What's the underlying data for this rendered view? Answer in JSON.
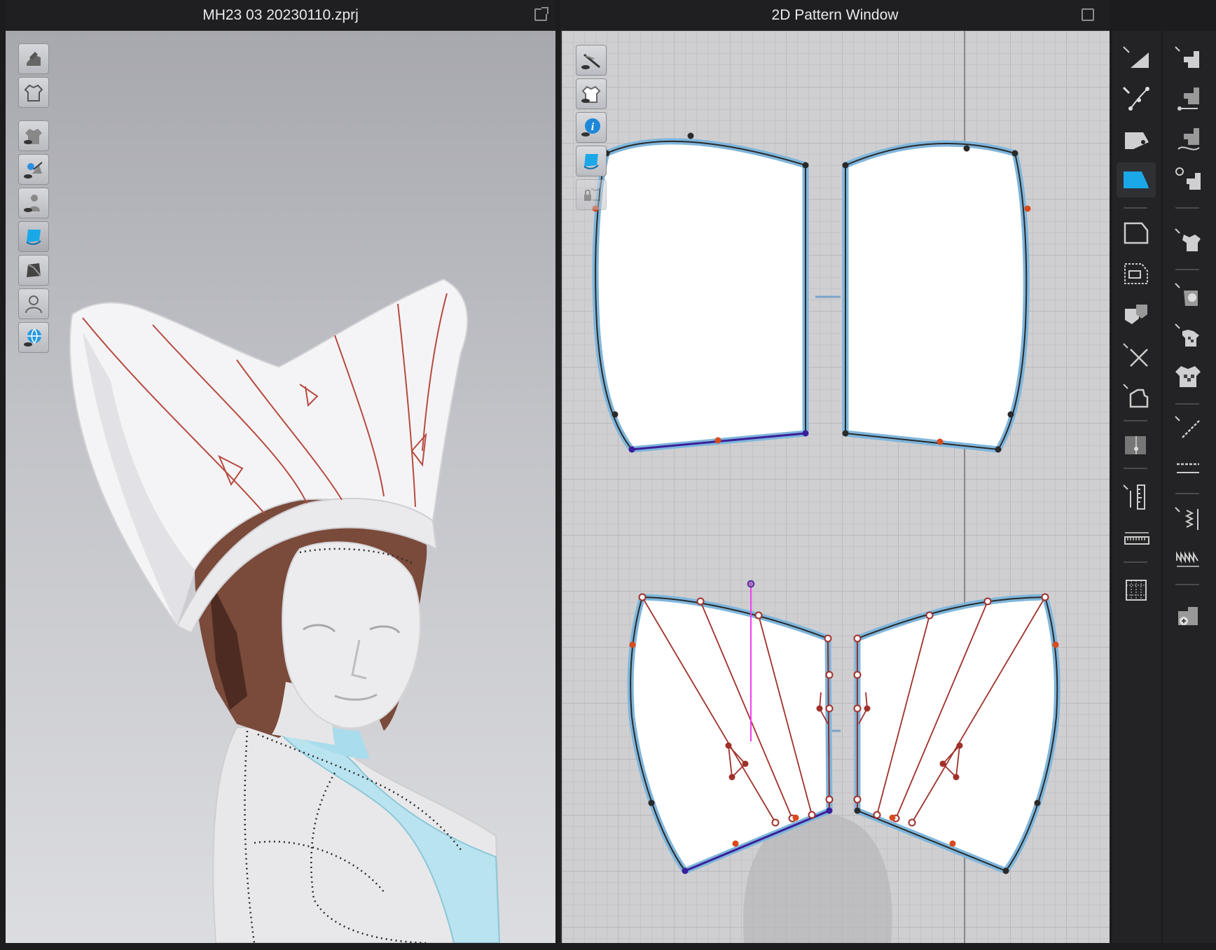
{
  "window_3d": {
    "title": "MH23 03 20230110.zprj"
  },
  "window_2d": {
    "title": "2D Pattern Window"
  },
  "tools_3d": [
    {
      "name": "tool-3d-avatar-display-icon"
    },
    {
      "name": "tool-3d-garment-display-icon"
    },
    {
      "name": "tool-3d-show-garment-icon"
    },
    {
      "name": "tool-3d-show-pin-icon"
    },
    {
      "name": "tool-3d-show-avatar-icon"
    },
    {
      "name": "tool-3d-fabric-render-icon",
      "active": true
    },
    {
      "name": "tool-3d-texture-icon"
    },
    {
      "name": "tool-3d-avatar-silhouette-icon"
    },
    {
      "name": "tool-3d-world-icon"
    }
  ],
  "tools_2d": [
    {
      "name": "tool-2d-show-baseline-icon"
    },
    {
      "name": "tool-2d-show-garment-icon"
    },
    {
      "name": "tool-2d-info-icon"
    },
    {
      "name": "tool-2d-fabric-icon"
    },
    {
      "name": "tool-2d-lock-icon"
    }
  ],
  "right_toolbar": {
    "left_column": [
      "transform-pattern-icon",
      "edit-curvature-icon",
      "edit-point-icon",
      "polygon-fill-icon",
      "rectangle-icon",
      "internal-rectangle-icon",
      "trace-icon",
      "cut-icon",
      "internal-polygon-icon",
      "fold-arrangement-icon",
      "measure-icon",
      "ruler-icon",
      "grid-icon"
    ],
    "right_column": [
      "segment-sewing-icon",
      "free-sewing-icon",
      "check-sewing-icon",
      "tack-icon",
      "fold-garment-icon",
      "pin-icon",
      "checker-icon",
      "checker-shirt-icon",
      "line-icon",
      "dashed-line-icon",
      "zigzag-icon",
      "wave-stitch-icon",
      "add-avatar-icon"
    ]
  },
  "colors": {
    "pattern_outline": "#7fb6dc",
    "internal_line": "#a0302a",
    "vertex_black": "#2a2a2a",
    "vertex_orange": "#d94a1c",
    "vertex_purple": "#3b1f9a",
    "selection_line": "#f23ef0",
    "active_tool_cyan": "#1aa8e8"
  }
}
